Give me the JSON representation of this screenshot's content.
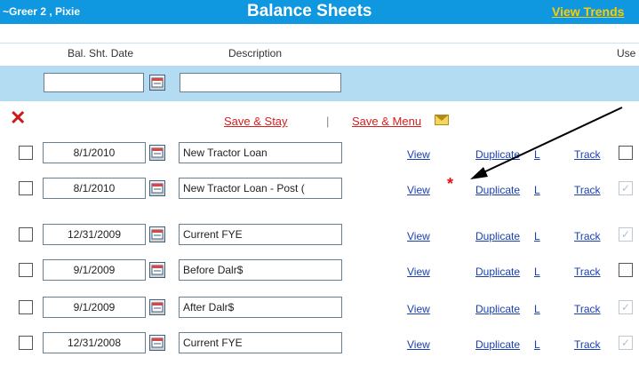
{
  "header": {
    "client": "~Greer 2 , Pixie",
    "title": "Balance Sheets",
    "trends_link": "View Trends"
  },
  "columns": {
    "date": "Bal. Sht. Date",
    "description": "Description",
    "use": "Use"
  },
  "actions": {
    "save_stay": "Save & Stay",
    "separator": "|",
    "save_menu": "Save & Menu"
  },
  "links": {
    "view": "View",
    "duplicate": "Duplicate",
    "l": "L",
    "track": "Track"
  },
  "rows": [
    {
      "date": "8/1/2010",
      "description": "New Tractor Loan",
      "use_checked": false,
      "use_disabled": false
    },
    {
      "date": "8/1/2010",
      "description": "New Tractor Loan - Post (",
      "use_checked": true,
      "use_disabled": true,
      "starred": true
    },
    {
      "date": "12/31/2009",
      "description": "Current FYE",
      "use_checked": true,
      "use_disabled": true
    },
    {
      "date": "9/1/2009",
      "description": "Before Dalr$",
      "use_checked": false,
      "use_disabled": false
    },
    {
      "date": "9/1/2009",
      "description": "After Dalr$",
      "use_checked": true,
      "use_disabled": true
    },
    {
      "date": "12/31/2008",
      "description": "Current FYE",
      "use_checked": true,
      "use_disabled": true
    }
  ],
  "annotation": {
    "star": "*"
  },
  "colors": {
    "header_bg": "#0f97df",
    "filter_band": "#b3dcf3",
    "link": "#1a3fae",
    "save_red": "#d42020",
    "trends_yellow": "#ffcc00"
  }
}
